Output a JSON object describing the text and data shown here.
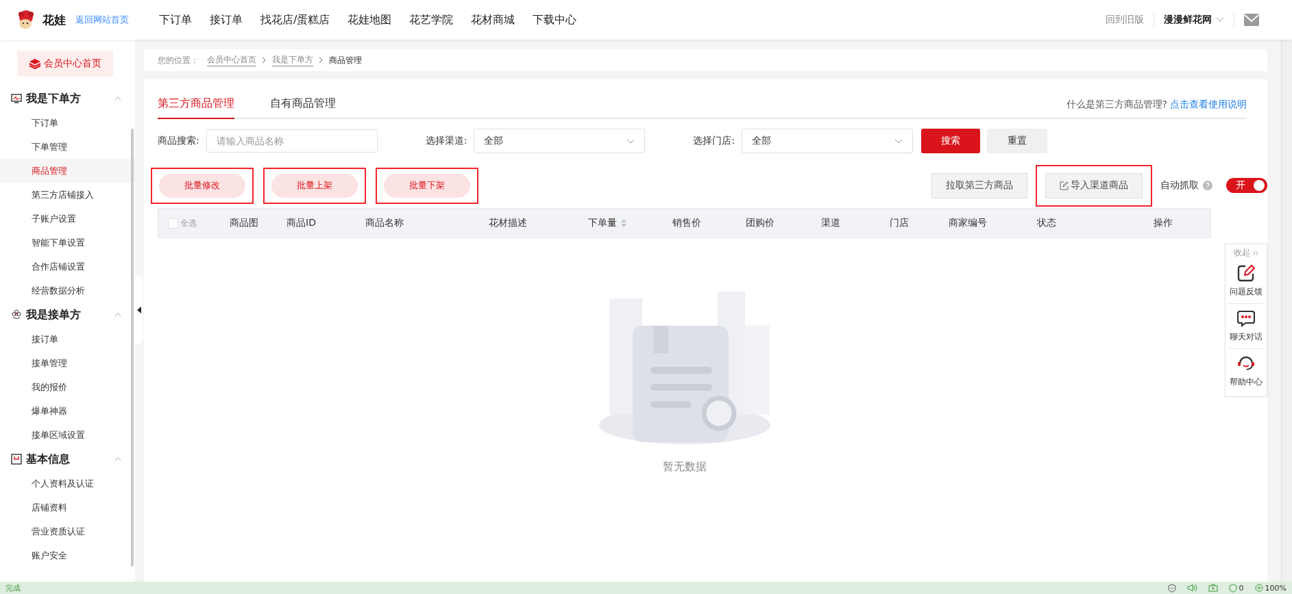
{
  "header": {
    "logo_text": "花娃",
    "home_link": "返回网站首页",
    "nav": [
      "下订单",
      "接订单",
      "找花店/蛋糕店",
      "花娃地图",
      "花艺学院",
      "花材商城",
      "下载中心"
    ],
    "old_version": "回到旧版",
    "account": "漫漫鲜花网"
  },
  "sidebar": {
    "home_button": "会员中心首页",
    "groups": [
      {
        "title": "我是下单方",
        "kind": "monitor",
        "expanded": true,
        "items": [
          {
            "label": "下订单",
            "selected": false
          },
          {
            "label": "下单管理",
            "selected": false
          },
          {
            "label": "商品管理",
            "selected": true
          },
          {
            "label": "第三方店铺接入",
            "selected": false
          },
          {
            "label": "子账户设置",
            "selected": false
          },
          {
            "label": "智能下单设置",
            "selected": false
          },
          {
            "label": "合作店铺设置",
            "selected": false
          },
          {
            "label": "经营数据分析",
            "selected": false
          }
        ]
      },
      {
        "title": "我是接单方",
        "kind": "flower",
        "expanded": true,
        "items": [
          {
            "label": "接订单",
            "selected": false
          },
          {
            "label": "接单管理",
            "selected": false
          },
          {
            "label": "我的报价",
            "selected": false
          },
          {
            "label": "爆单神器",
            "selected": false
          },
          {
            "label": "接单区域设置",
            "selected": false
          }
        ]
      },
      {
        "title": "基本信息",
        "kind": "box",
        "expanded": true,
        "items": [
          {
            "label": "个人资料及认证",
            "selected": false
          },
          {
            "label": "店铺资料",
            "selected": false
          },
          {
            "label": "营业资质认证",
            "selected": false
          },
          {
            "label": "账户安全",
            "selected": false
          }
        ]
      }
    ]
  },
  "breadcrumb": {
    "label": "您的位置：",
    "items": [
      "会员中心首页",
      "我是下单方",
      "商品管理"
    ]
  },
  "tabs": [
    {
      "label": "第三方商品管理",
      "selected": true
    },
    {
      "label": "自有商品管理",
      "selected": false
    }
  ],
  "help": {
    "question": "什么是第三方商品管理?",
    "link": "点击查看使用说明"
  },
  "filters": {
    "search_label": "商品搜索:",
    "search_placeholder": "请输入商品名称",
    "channel_label": "选择渠道:",
    "channel_value": "全部",
    "store_label": "选择门店:",
    "store_value": "全部",
    "search_button": "搜索",
    "reset_button": "重置"
  },
  "batch_buttons": [
    {
      "label": "批量修改",
      "highlighted": true
    },
    {
      "label": "批量上架",
      "highlighted": true
    },
    {
      "label": "批量下架",
      "highlighted": true
    }
  ],
  "actions": [
    {
      "label": "拉取第三方商品",
      "kind": "plain",
      "highlighted": false
    },
    {
      "label": "导入渠道商品",
      "kind": "import",
      "highlighted": true
    }
  ],
  "auto_fetch": {
    "label": "自动抓取",
    "on": true,
    "toggle_text": "开"
  },
  "table": {
    "select_all": "全选",
    "checked": false,
    "columns": [
      {
        "label": "商品图",
        "sortable": false
      },
      {
        "label": "商品ID",
        "sortable": false
      },
      {
        "label": "商品名称",
        "sortable": false
      },
      {
        "label": "花材描述",
        "sortable": false
      },
      {
        "label": "下单量",
        "sortable": true
      },
      {
        "label": "销售价",
        "sortable": false
      },
      {
        "label": "团购价",
        "sortable": false
      },
      {
        "label": "渠道",
        "sortable": false
      },
      {
        "label": "门店",
        "sortable": false
      },
      {
        "label": "商家编号",
        "sortable": false
      },
      {
        "label": "状态",
        "sortable": false
      },
      {
        "label": "操作",
        "sortable": false
      }
    ],
    "empty_text": "暂无数据"
  },
  "float_panel": {
    "collapse": "收起",
    "items": [
      {
        "kind": "feedback",
        "label": "问题反馈"
      },
      {
        "kind": "chat",
        "label": "聊天对话"
      },
      {
        "kind": "help",
        "label": "帮助中心"
      }
    ]
  },
  "status_bar": {
    "text": "完成",
    "shield_count": "0",
    "zoom": "100%"
  }
}
